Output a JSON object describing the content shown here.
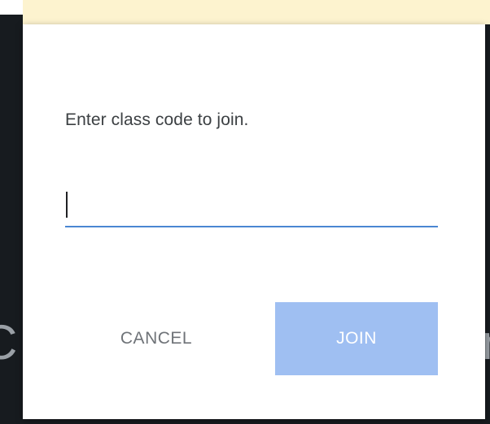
{
  "dialog": {
    "prompt": "Enter class code to join.",
    "input": {
      "value": "",
      "placeholder": ""
    },
    "buttons": {
      "cancel_label": "CANCEL",
      "join_label": "JOIN"
    }
  },
  "colors": {
    "accent_underline": "#4a86d2",
    "join_button_disabled": "#9fbff2",
    "backdrop": "#171b1f",
    "top_band": "#fdf3cf"
  }
}
